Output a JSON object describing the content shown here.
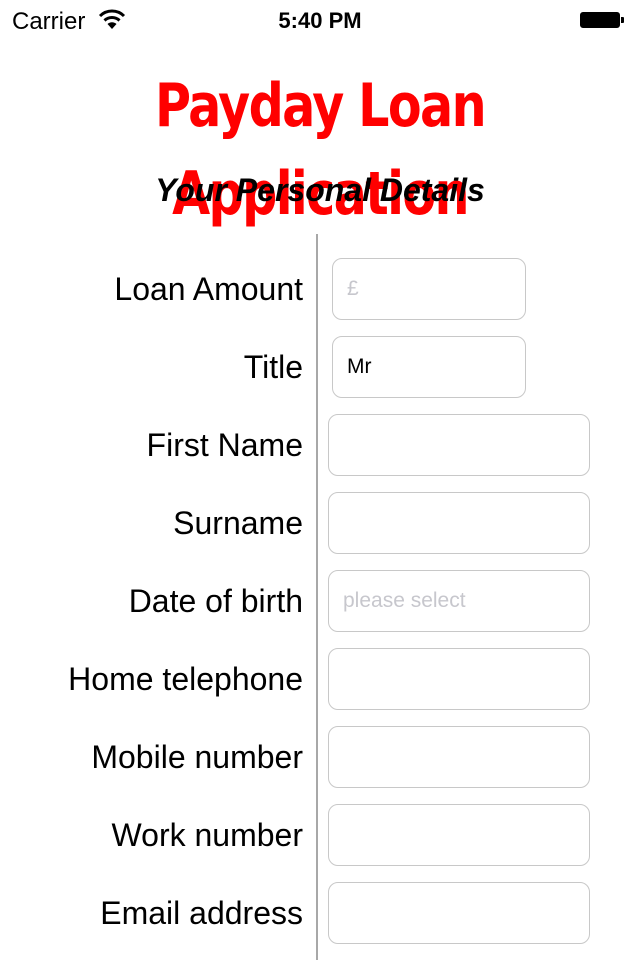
{
  "status_bar": {
    "carrier": "Carrier",
    "wifi_icon": "wifi-icon",
    "time": "5:40 PM",
    "battery_icon": "battery-full-icon"
  },
  "header": {
    "title": "Payday Loan Application",
    "title_color": "#ff0000",
    "subtitle": "Your Personal Details"
  },
  "form": {
    "fields": [
      {
        "label": "Loan Amount",
        "value": "",
        "placeholder": "£"
      },
      {
        "label": "Title",
        "value": "Mr",
        "placeholder": ""
      },
      {
        "label": "First Name",
        "value": "",
        "placeholder": ""
      },
      {
        "label": "Surname",
        "value": "",
        "placeholder": ""
      },
      {
        "label": "Date of birth",
        "value": "",
        "placeholder": "please select"
      },
      {
        "label": "Home telephone",
        "value": "",
        "placeholder": ""
      },
      {
        "label": "Mobile number",
        "value": "",
        "placeholder": ""
      },
      {
        "label": "Work number",
        "value": "",
        "placeholder": ""
      },
      {
        "label": "Email address",
        "value": "",
        "placeholder": ""
      }
    ]
  }
}
